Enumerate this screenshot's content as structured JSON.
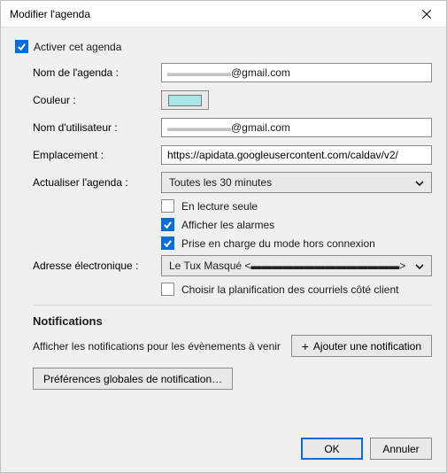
{
  "window": {
    "title": "Modifier l'agenda"
  },
  "activate": {
    "checked": true,
    "label": "Activer cet agenda"
  },
  "fields": {
    "name_label": "Nom de l'agenda :",
    "name_value_suffix": "@gmail.com",
    "color_label": "Couleur :",
    "color_value": "#a8e5e5",
    "username_label": "Nom d'utilisateur :",
    "username_value_suffix": "@gmail.com",
    "location_label": "Emplacement :",
    "location_value": "https://apidata.googleusercontent.com/caldav/v2/",
    "refresh_label": "Actualiser l'agenda :",
    "refresh_value": "Toutes les 30 minutes",
    "readonly_label": "En lecture seule",
    "readonly_checked": false,
    "alarms_label": "Afficher les alarmes",
    "alarms_checked": true,
    "offline_label": "Prise en charge du mode hors connexion",
    "offline_checked": true,
    "email_label": "Adresse électronique :",
    "email_value_prefix": "Le Tux Masqué <",
    "email_value_suffix": ">",
    "client_scheduling_label": "Choisir la planification des courriels côté client",
    "client_scheduling_checked": false
  },
  "notifications": {
    "heading": "Notifications",
    "description": "Afficher les notifications pour les évènements à venir",
    "add_button": "Ajouter une notification",
    "global_prefs_button": "Préférences globales de notification…"
  },
  "footer": {
    "ok": "OK",
    "cancel": "Annuler"
  }
}
